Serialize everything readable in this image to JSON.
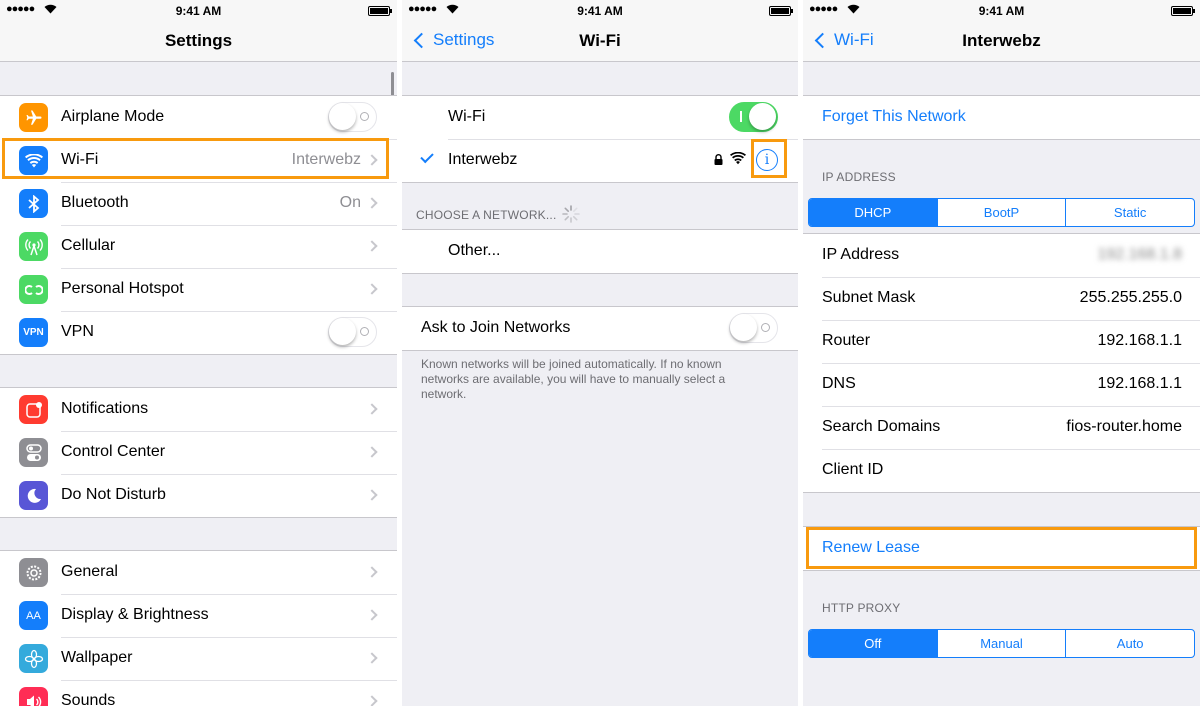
{
  "status": {
    "time": "9:41 AM",
    "signal": "●●●●●"
  },
  "settings": {
    "title": "Settings",
    "group1": [
      {
        "label": "Airplane Mode",
        "icon": "airplane-icon",
        "color": "#ff9500",
        "toggle": "off"
      },
      {
        "label": "Wi-Fi",
        "value": "Interwebz",
        "icon": "wifi-icon",
        "color": "#147efb"
      },
      {
        "label": "Bluetooth",
        "value": "On",
        "icon": "bluetooth-icon",
        "color": "#147efb"
      },
      {
        "label": "Cellular",
        "icon": "cellular-icon",
        "color": "#4cd964"
      },
      {
        "label": "Personal Hotspot",
        "icon": "hotspot-icon",
        "color": "#4cd964"
      },
      {
        "label": "VPN",
        "icon": "vpn-icon",
        "color": "#147efb",
        "icon_text": "VPN",
        "toggle": "off"
      }
    ],
    "group2": [
      {
        "label": "Notifications",
        "icon": "notifications-icon",
        "color": "#ff3b30"
      },
      {
        "label": "Control Center",
        "icon": "control-center-icon",
        "color": "#8e8e93"
      },
      {
        "label": "Do Not Disturb",
        "icon": "moon-icon",
        "color": "#5856d6"
      }
    ],
    "group3": [
      {
        "label": "General",
        "icon": "gear-icon",
        "color": "#8e8e93"
      },
      {
        "label": "Display & Brightness",
        "icon": "display-icon",
        "color": "#147efb",
        "icon_text": "AA"
      },
      {
        "label": "Wallpaper",
        "icon": "wallpaper-icon",
        "color": "#34aadc"
      },
      {
        "label": "Sounds",
        "icon": "sounds-icon",
        "color": "#ff2d55"
      }
    ]
  },
  "wifi": {
    "back_label": "Settings",
    "title": "Wi-Fi",
    "wifi_label": "Wi-Fi",
    "network_name": "Interwebz",
    "choose_header": "CHOOSE A NETWORK...",
    "other_label": "Other...",
    "ask_label": "Ask to Join Networks",
    "footer": "Known networks will be joined automatically. If no known networks are available, you will have to manually select a network.",
    "accent": "#147efb",
    "toggle_on_color": "#4cd964"
  },
  "network": {
    "back_label": "Wi-Fi",
    "title": "Interwebz",
    "forget_label": "Forget This Network",
    "ip_header": "IP ADDRESS",
    "ip_modes": [
      "DHCP",
      "BootP",
      "Static"
    ],
    "ip_mode_selected": "DHCP",
    "rows": [
      {
        "label": "IP Address",
        "value": "192.168.1.8",
        "blurred": true
      },
      {
        "label": "Subnet Mask",
        "value": "255.255.255.0"
      },
      {
        "label": "Router",
        "value": "192.168.1.1"
      },
      {
        "label": "DNS",
        "value": "192.168.1.1"
      },
      {
        "label": "Search Domains",
        "value": "fios-router.home"
      },
      {
        "label": "Client ID",
        "value": ""
      }
    ],
    "renew_label": "Renew Lease",
    "proxy_header": "HTTP PROXY",
    "proxy_modes": [
      "Off",
      "Manual",
      "Auto"
    ],
    "proxy_mode_selected": "Off"
  },
  "highlight_color": "#f89a0e"
}
